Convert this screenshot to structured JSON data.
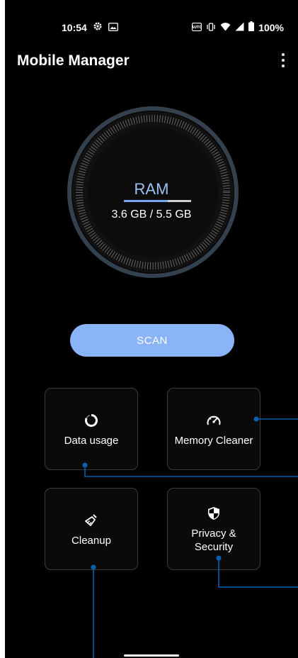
{
  "status_bar": {
    "time": "10:54",
    "battery": "100%",
    "icons": [
      "gear-icon",
      "image-icon",
      "auto-brightness-icon",
      "vibrate-icon",
      "wifi-icon",
      "cellular-signal-icon",
      "battery-icon"
    ]
  },
  "app_bar": {
    "title": "Mobile Manager",
    "menu_icon": "more-vert-icon"
  },
  "ram_gauge": {
    "label": "RAM",
    "value": "3.6 GB / 5.5 GB",
    "used_fraction": 0.65,
    "accent": "#8ab4f8"
  },
  "scan_button": {
    "label": "SCAN",
    "color": "#8ab4f8"
  },
  "tiles": [
    {
      "label": "Data usage",
      "icon": "data-usage-icon"
    },
    {
      "label": "Memory Cleaner",
      "icon": "speedometer-icon"
    },
    {
      "label": "Cleanup",
      "icon": "broom-icon"
    },
    {
      "label": "Privacy & Security",
      "icon": "shield-icon"
    }
  ],
  "callout_color": "#0b5fad"
}
